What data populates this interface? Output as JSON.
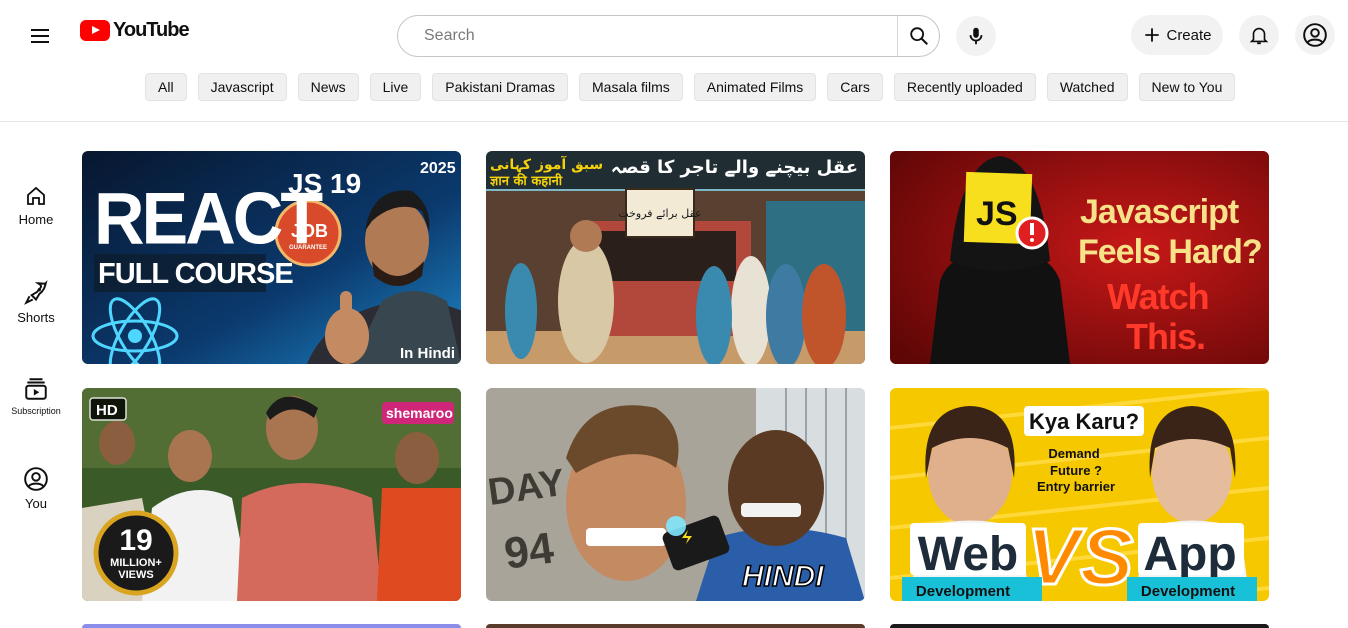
{
  "header": {
    "logo_text": "YouTube",
    "search_placeholder": "Search",
    "create_label": "Create"
  },
  "chips": [
    "All",
    "Javascript",
    "News",
    "Live",
    "Pakistani Dramas",
    "Masala films",
    "Animated Films",
    "Cars",
    "Recently uploaded",
    "Watched",
    "New to You"
  ],
  "sidebar": {
    "items": [
      {
        "label": "Home",
        "icon": "home-icon"
      },
      {
        "label": "Shorts",
        "icon": "shorts-icon"
      },
      {
        "label": "Subscription",
        "icon": "subscriptions-icon"
      },
      {
        "label": "You",
        "icon": "you-icon"
      }
    ]
  },
  "videos": [
    {
      "thumb_text": [
        "REACT",
        "JS 19",
        "2025",
        "JOB",
        "GUARANTEE",
        "FULL COURSE",
        "In Hindi"
      ]
    },
    {
      "thumb_text": [
        "عقل بیچنے والے تاجر کا قصہ",
        "سبق آموز کہانی",
        "ज्ञान की कहानी",
        "عقل برائے فروخت"
      ]
    },
    {
      "thumb_text": [
        "JS",
        "Javascript",
        "Feels Hard?",
        "Watch",
        "This."
      ]
    },
    {
      "thumb_text": [
        "HD",
        "shemaroo",
        "19",
        "MILLION+",
        "VIEWS"
      ]
    },
    {
      "thumb_text": [
        "DAY",
        "94",
        "HINDI"
      ]
    },
    {
      "thumb_text": [
        "Kya Karu?",
        "Demand",
        "Future ?",
        "Entry barrier",
        "Web",
        "VS",
        "App",
        "Development",
        "Development"
      ]
    }
  ],
  "colors": {
    "brand_red": "#ff0000",
    "chip_bg": "#f0f0f0",
    "js_yellow": "#f7df1e"
  }
}
